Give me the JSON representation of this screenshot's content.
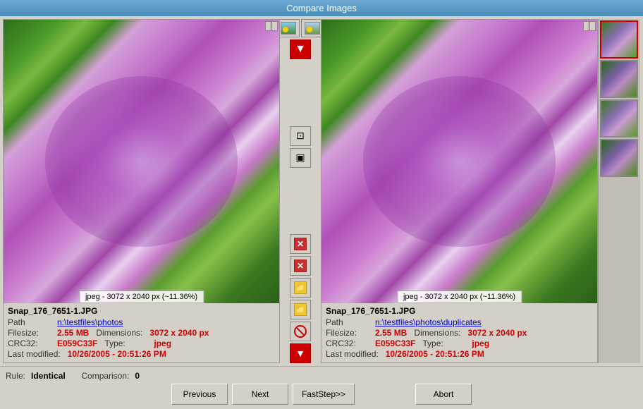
{
  "window": {
    "title": "Compare Images"
  },
  "left_image": {
    "filename": "Snap_176_7651-1.JPG",
    "path_label": "Path",
    "path_value": "n:\\testfiles\\photos",
    "filesize_label": "Filesize:",
    "filesize_value": "2.55 MB",
    "dimensions_label": "Dimensions:",
    "dimensions_value": "3072 x 2040 px",
    "crc_label": "CRC32:",
    "crc_value": "E059C33F",
    "type_label": "Type:",
    "type_value": "jpeg",
    "modified_label": "Last modified:",
    "modified_value": "10/26/2005 - 20:51:26 PM",
    "image_label": "jpeg - 3072 x 2040 px (~11.36%)"
  },
  "right_image": {
    "filename": "Snap_176_7651-1.JPG",
    "path_label": "Path",
    "path_value": "n:\\testfiles\\photos\\duplicates",
    "filesize_label": "Filesize:",
    "filesize_value": "2.55 MB",
    "dimensions_label": "Dimensions:",
    "dimensions_value": "3072 x 2040 px",
    "crc_label": "CRC32:",
    "crc_value": "E059C33F",
    "type_label": "Type:",
    "type_value": "jpeg",
    "modified_label": "Last modified:",
    "modified_value": "10/26/2005 - 20:51:26 PM",
    "image_label": "jpeg - 3072 x 2040 px (~11.36%)"
  },
  "bottom": {
    "rule_label": "Rule:",
    "rule_value": "Identical",
    "comparison_label": "Comparison:",
    "comparison_value": "0"
  },
  "buttons": {
    "previous": "Previous",
    "next": "Next",
    "faststep": "FastStep>>",
    "abort": "Abort"
  }
}
